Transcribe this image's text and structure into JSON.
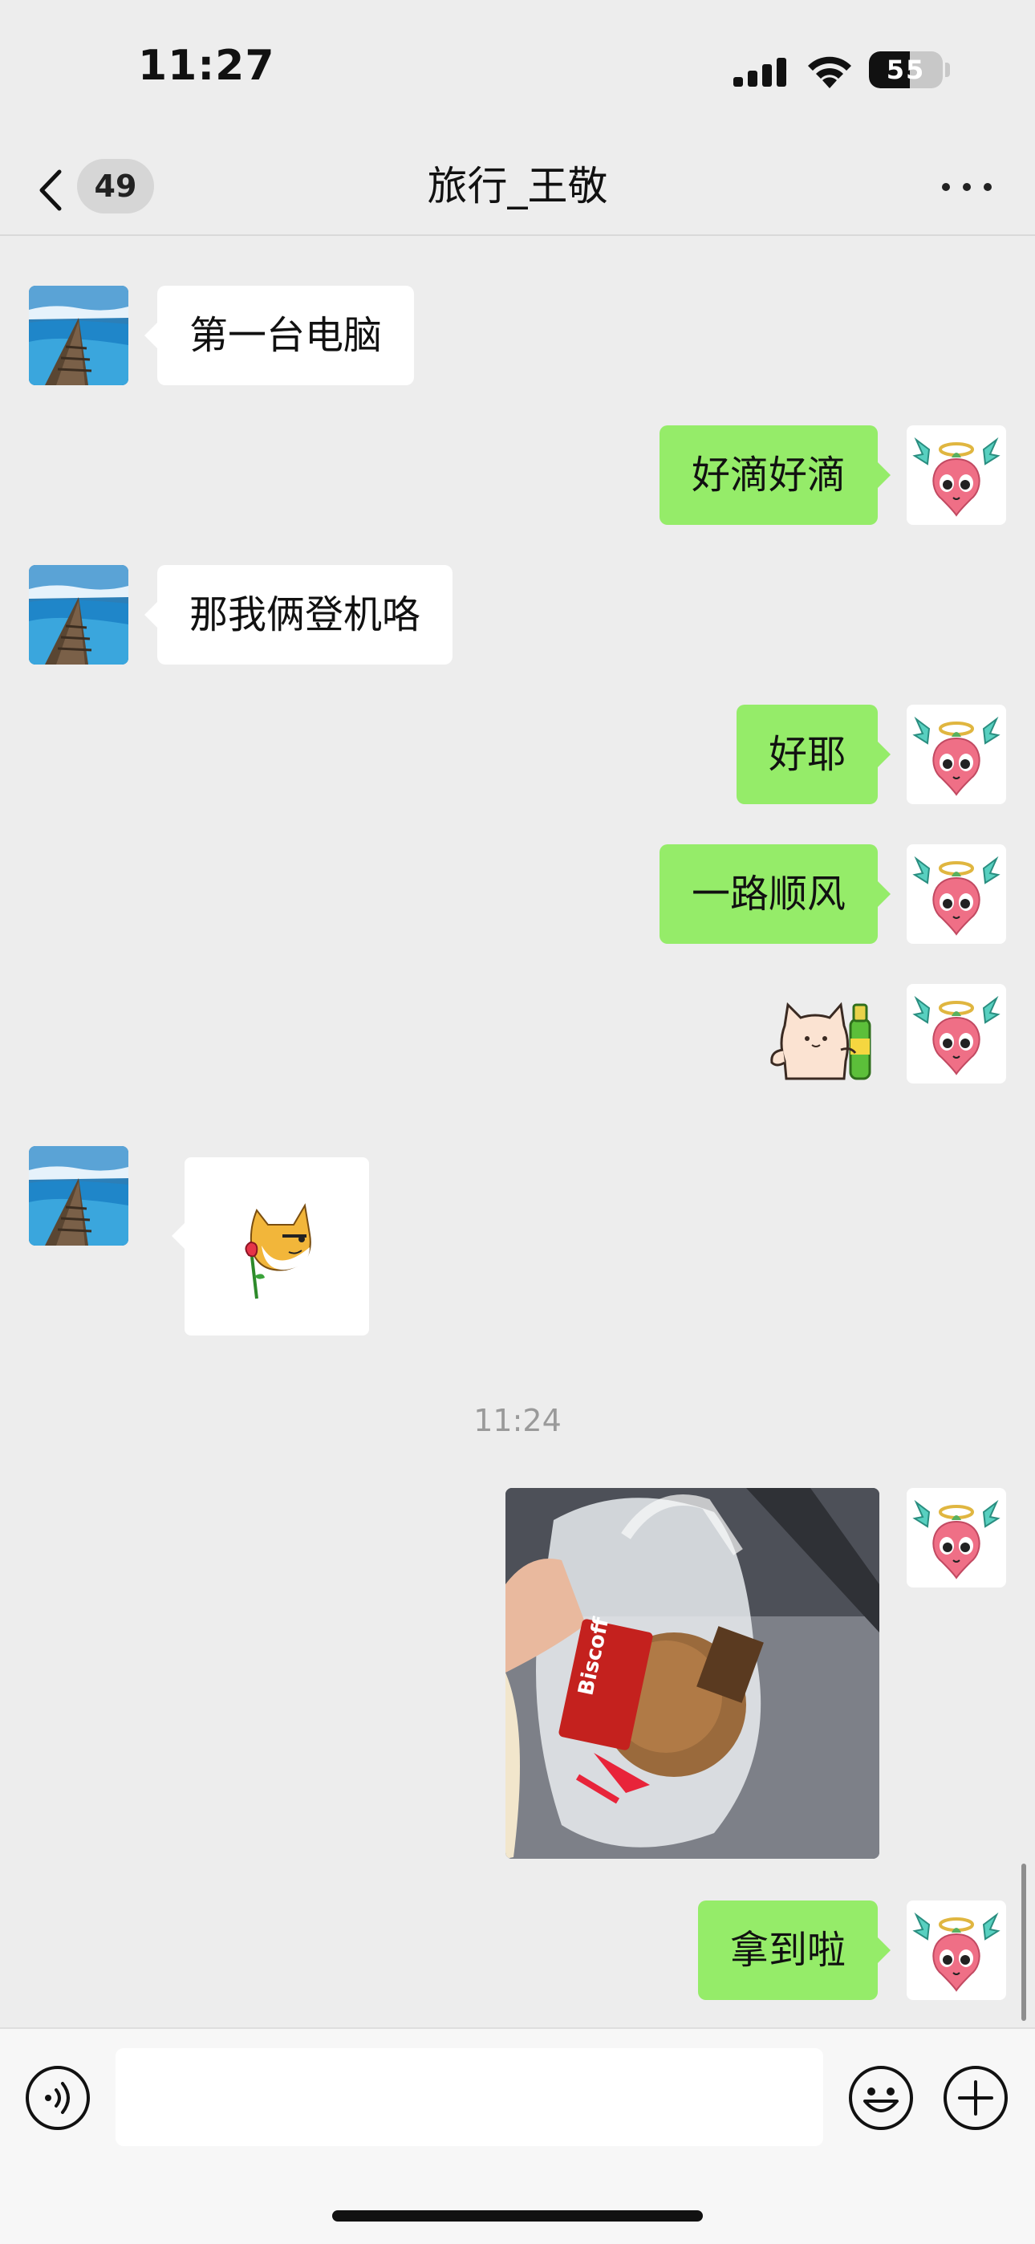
{
  "status_bar": {
    "time": "11:27",
    "battery_level": "55",
    "battery_fraction": 0.55,
    "signal_icon": "cellular-signal-icon",
    "wifi_icon": "wifi-icon"
  },
  "nav": {
    "back_icon": "chevron-left-icon",
    "unread_count": "49",
    "title": "旅行_王敬",
    "more_icon": "more-horizontal-icon"
  },
  "messages": [
    {
      "direction": "incoming",
      "type": "text",
      "text": "第一台电脑"
    },
    {
      "direction": "outgoing",
      "type": "text",
      "text": "好滴好滴"
    },
    {
      "direction": "incoming",
      "type": "text",
      "text": "那我俩登机咯"
    },
    {
      "direction": "outgoing",
      "type": "text",
      "text": "好耶"
    },
    {
      "direction": "outgoing",
      "type": "text",
      "text": "一路顺风"
    },
    {
      "direction": "outgoing",
      "type": "sticker",
      "icon": "cat-with-drink-sticker"
    },
    {
      "direction": "incoming",
      "type": "sticker",
      "icon": "shiba-with-rose-sticker"
    },
    {
      "type": "timestamp",
      "text": "11:24"
    },
    {
      "direction": "outgoing",
      "type": "image",
      "icon": "photo-biscoff-snack-bag"
    },
    {
      "direction": "outgoing",
      "type": "text",
      "text": "拿到啦"
    }
  ],
  "avatars": {
    "contact": "ocean-pier-avatar",
    "self": "pink-radish-angel-avatar"
  },
  "input_bar": {
    "voice_icon": "voice-input-icon",
    "text_value": "",
    "emoji_icon": "emoji-icon",
    "plus_icon": "plus-circle-icon"
  },
  "colors": {
    "background": "#ededed",
    "outgoing_bubble": "#95ec69",
    "incoming_bubble": "#ffffff",
    "timestamp": "#9a9a9a"
  }
}
